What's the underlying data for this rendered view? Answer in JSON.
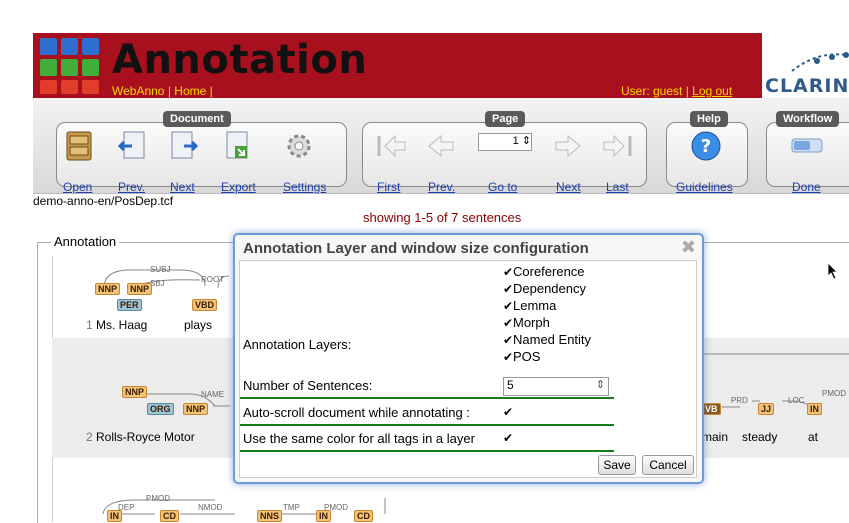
{
  "header": {
    "title": "Annotation",
    "nav": {
      "webanno": "WebAnno",
      "sep1": " | ",
      "home": "Home",
      "sep2": " |"
    },
    "user_prefix": "User: guest | ",
    "logout": "Log out",
    "clarin": "CLARIN-I",
    "colors": {
      "brand": "#a8101e",
      "link": "#ffd400"
    }
  },
  "toolbar": {
    "document": {
      "label": "Document",
      "open": "Open",
      "prev": "Prev.",
      "next": "Next",
      "export": "Export",
      "settings": "Settings"
    },
    "page": {
      "label": "Page",
      "value": "1",
      "first": "First",
      "prev": "Prev.",
      "goto": "Go to",
      "next": "Next",
      "last": "Last"
    },
    "help": {
      "label": "Help",
      "guidelines": "Guidelines"
    },
    "workflow": {
      "label": "Workflow",
      "done": "Done"
    }
  },
  "document": {
    "filename": "demo-anno-en/PosDep.tcf",
    "showing": "showing 1-5 of 7 sentences"
  },
  "annotation": {
    "legend": "Annotation",
    "sentence1": {
      "num": "1",
      "tokens": [
        "Ms. Haag",
        "plays"
      ],
      "tags": [
        "NNP",
        "NNP",
        "PER",
        "VBD"
      ],
      "arcs": [
        "SUBJ",
        "SBJ",
        "ROOT"
      ]
    },
    "sentence2": {
      "num": "2",
      "tokens": [
        "Rolls-Royce Motor",
        "main",
        "steady",
        "at"
      ],
      "tags": [
        "NNP",
        "ORG",
        "NNP",
        "VB",
        "JJ",
        "IN"
      ],
      "arcs": [
        "NAME",
        "PRD",
        "LOC",
        "PMOD"
      ]
    },
    "sentence3": {
      "tags": [
        "IN",
        "CD",
        "NNS",
        "IN",
        "CD"
      ],
      "arcs": [
        "PMOD",
        "DEP",
        "NMOD",
        "TMP",
        "PMOD"
      ]
    }
  },
  "dialog": {
    "title": "Annotation Layer and window size configuration",
    "close": "✖",
    "layers_label": "Annotation Layers:",
    "layers": [
      "Coreference",
      "Dependency",
      "Lemma",
      "Morph",
      "Named Entity",
      "POS"
    ],
    "sentences_label": "Number of Sentences:",
    "sentences_value": "5",
    "autoscroll_label": "Auto-scroll document while annotating :",
    "samecolor_label": "Use the same color for all tags in a layer",
    "check_glyph": "✔",
    "save": "Save",
    "cancel": "Cancel"
  }
}
